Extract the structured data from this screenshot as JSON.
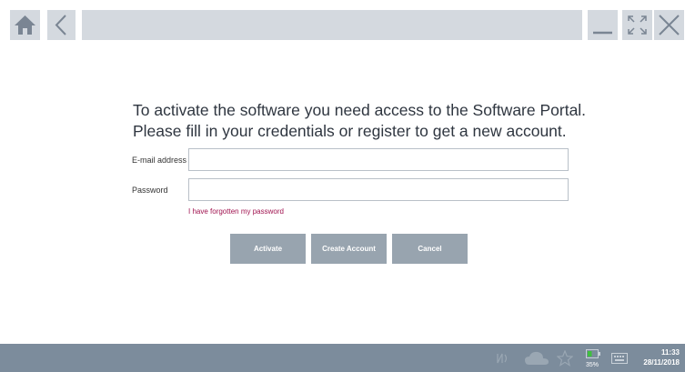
{
  "toolbar": {
    "home_icon": "home-icon",
    "back_icon": "chevron-left-icon",
    "minimize_icon": "minimize-icon",
    "maximize_icon": "maximize-icon",
    "close_icon": "close-icon"
  },
  "main": {
    "heading_line1": "To activate the software you need access to the Software Portal.",
    "heading_line2": "Please fill in your credentials or register to get a new account.",
    "email_label": "E-mail address",
    "email_value": "",
    "password_label": "Password",
    "password_value": "",
    "forgot_link": "I have forgotten my password",
    "activate_label": "Activate",
    "create_account_label": "Create Account",
    "cancel_label": "Cancel"
  },
  "taskbar": {
    "icons": [
      "nfc-icon",
      "cloud-icon",
      "star-icon",
      "battery-icon",
      "keyboard-icon"
    ],
    "battery_percent": "35%",
    "time": "11:33",
    "date": "28/11/2018"
  },
  "colors": {
    "toolbar_button": "#d4d9df",
    "action_button": "#98a4af",
    "taskbar": "#7c8c9c",
    "link": "#a0134f",
    "heading_text": "#2f3640"
  }
}
